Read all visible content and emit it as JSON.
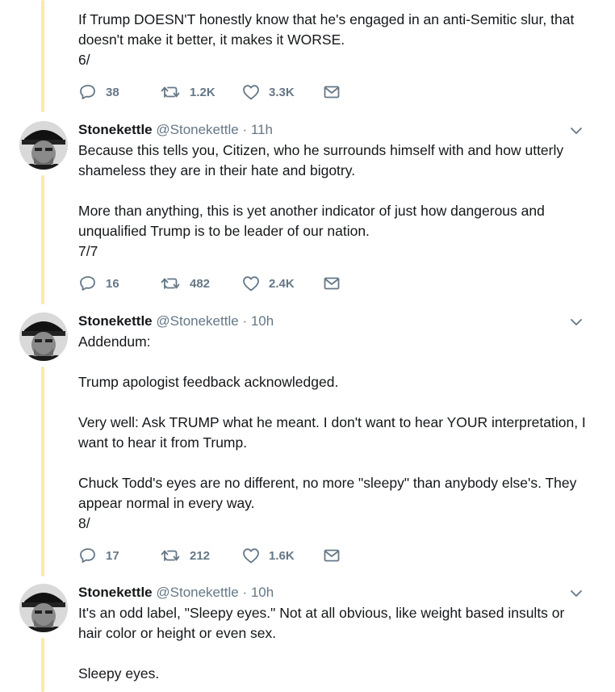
{
  "tweets": [
    {
      "paragraphs": [
        "If Trump DOESN'T honestly know that he's engaged in an anti-Semitic slur, that doesn't make it better, it makes it WORSE.",
        "6/"
      ],
      "replies": "38",
      "retweets": "1.2K",
      "likes": "3.3K"
    },
    {
      "name": "Stonekettle",
      "handle": "@Stonekettle",
      "dot": "·",
      "time": "11h",
      "paragraphs": [
        "Because this tells you, Citizen, who he surrounds himself with and how utterly shameless they are in their hate and bigotry.",
        "More than anything, this is yet another indicator of just how dangerous and unqualified Trump is to be leader of our nation.",
        "7/7"
      ],
      "replies": "16",
      "retweets": "482",
      "likes": "2.4K"
    },
    {
      "name": "Stonekettle",
      "handle": "@Stonekettle",
      "dot": "·",
      "time": "10h",
      "paragraphs": [
        "Addendum:",
        "Trump apologist feedback acknowledged.",
        "Very well: Ask TRUMP what he meant. I don't want to hear YOUR interpretation, I want to hear it from Trump.",
        "Chuck Todd's eyes are no different, no more \"sleepy\" than anybody else's. They appear normal in every way.",
        "8/"
      ],
      "replies": "17",
      "retweets": "212",
      "likes": "1.6K"
    },
    {
      "name": "Stonekettle",
      "handle": "@Stonekettle",
      "dot": "·",
      "time": "10h",
      "paragraphs": [
        "It's an odd label, \"Sleepy eyes.\" Not at all obvious, like weight based insults or hair color or height or even sex.",
        "Sleepy eyes."
      ]
    }
  ],
  "icons": {
    "reply": "reply-icon",
    "retweet": "retweet-icon",
    "like": "heart-icon",
    "message": "envelope-icon",
    "more": "chevron-down-icon"
  },
  "colors": {
    "thread_line": "#fce9a8",
    "secondary_text": "#657786",
    "primary_text": "#14171a"
  }
}
